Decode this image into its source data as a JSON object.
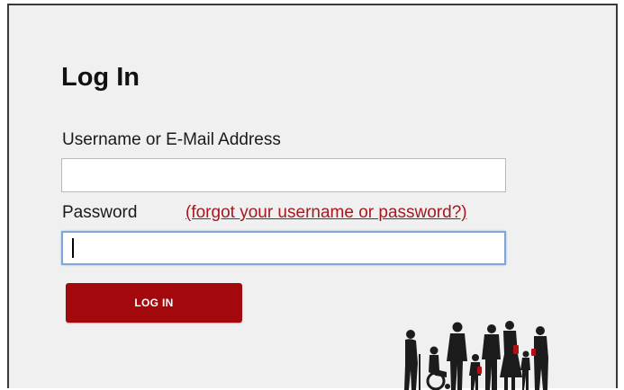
{
  "login": {
    "title": "Log In",
    "username_label": "Username or E-Mail Address",
    "username_value": "",
    "password_label": "Password",
    "password_value": "",
    "forgot_link": "(forgot your username or password?)",
    "submit_label": "LOG IN"
  },
  "colors": {
    "accent": "#a3080c",
    "link": "#a3191f",
    "panel_bg": "#f0f0f0",
    "focus_border": "#7ea7d8"
  },
  "logo": {
    "icon": "family-silhouette-icon"
  }
}
